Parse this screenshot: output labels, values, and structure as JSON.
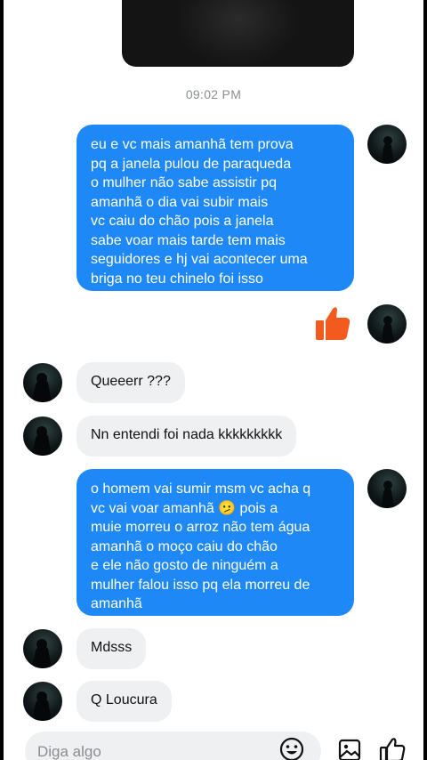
{
  "timestamp": "09:02 PM",
  "messages": {
    "out1": "eu e vc mais amanhã tem prova\npq a janela pulou de paraqueda\no mulher não sabe assistir pq\namanhã o dia vai subir mais\nvc caiu do chão pois a janela\nsabe voar mais tarde tem mais\nseguidores e hj vai acontecer uma\nbriga no teu chinelo foi isso",
    "in1": "Queeerr ???",
    "in2": "Nn entendi foi nada kkkkkkkkk",
    "out2": "o homem vai sumir msm vc acha q\nvc vai voar amanhã 🫤 pois a\nmuie morreu o arroz não tem água\namanhã o moço caiu do chão\ne ele  não gosto de ninguém a\nmulher falou isso pq ela morreu de\namanhã",
    "in3": "Mdsss",
    "in4": "Q Loucura"
  },
  "composer": {
    "placeholder": "Diga algo"
  },
  "icons": {
    "like": "thumbs-up-icon",
    "emoji": "emoji-icon",
    "image": "image-icon",
    "send_like": "thumbs-up-outline-icon"
  },
  "colors": {
    "outgoing_bubble": "#1e88f6",
    "incoming_bubble": "#eff0f2",
    "like_orange": "#f35a1e"
  }
}
